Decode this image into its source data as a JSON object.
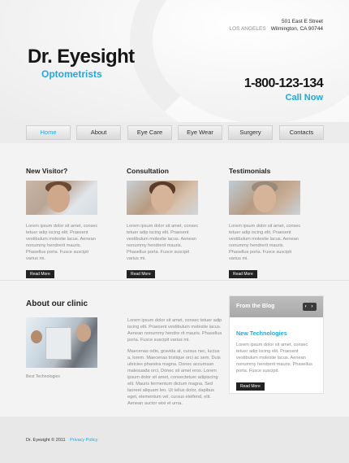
{
  "header": {
    "street": "501 East E Street",
    "city": "LOS ANGELES",
    "city_state_zip": "Wilmington, CA 90744",
    "logo_title": "Dr. Eyesight",
    "logo_subtitle": "Optometrists",
    "phone": "1-800-123-134",
    "call_now": "Call Now"
  },
  "nav": {
    "items": [
      "Home",
      "About",
      "Eye Care",
      "Eye Wear",
      "Surgery",
      "Contacts"
    ],
    "active": "Home"
  },
  "features": [
    {
      "title": "New Visitor?",
      "text": "Lorem ipsum dolor sit amet, consec tetuer adip iscing elit. Praesent vestibulum molestie lacus. Aenean nonummy hendrerit mauris. Phasellus porta. Fusce suscipit varius mi.",
      "button": "Read More"
    },
    {
      "title": "Consultation",
      "text": "Lorem ipsum dolor sit amet, consec tetuer adip iscing elit. Praesent vestibulum molestie lacus. Aenean nonummy hendrerit mauris. Phasellus porta. Fusce suscipit varius mi.",
      "button": "Read More"
    },
    {
      "title": "Testimonials",
      "text": "Lorem ipsum dolor sit amet, consec tetuer adip iscing elit. Praesent vestibulum molestie lacus. Aenean nonummy hendrerit mauris. Phasellus porta. Fusce suscipit varius mi.",
      "button": "Read More"
    }
  ],
  "about": {
    "title": "About our clinic",
    "caption": "Best Technologies",
    "paragraph1": "Lorem ipsum dolor sit amet, consec tetuer adip iscing elit. Praesent vestibulum molestie lacus. Aenean nonummy hendre rit mauris. Phasellus porta. Fusce suscipit varius mi.",
    "paragraph2": "Maecenas odio, gravida at, cursus nec, luctus a, lorem. Maecenas tristique orci ac sem. Duis ultricies pharetra magna. Donec accumsan malesuada orci. Donec sit amet eros. Lorem ipsum dolor sit amet, consectetuer adipiscing elit. Mauris fermentum dictum magna. Sed laoreet aliquam leo. Ut tellus dolor, dapibus eget, elementum vel, cursus eleifend, elit. Aenean auctor wisi et urna."
  },
  "blog": {
    "header": "From the Blog",
    "arrows": "‹ ›",
    "post_title": "New Technologies",
    "post_text": "Lorem ipsum dolor sit amet, consec tetuer adip iscing elit. Praesent vestibulum molestie lacus. Aenean nonummy hendrerit mauris. Phasellus porta. Fusce suscipit.",
    "button": "Read More"
  },
  "footer": {
    "copyright": "Dr. Eyesight © 2011",
    "policy": "Privacy Policy"
  }
}
